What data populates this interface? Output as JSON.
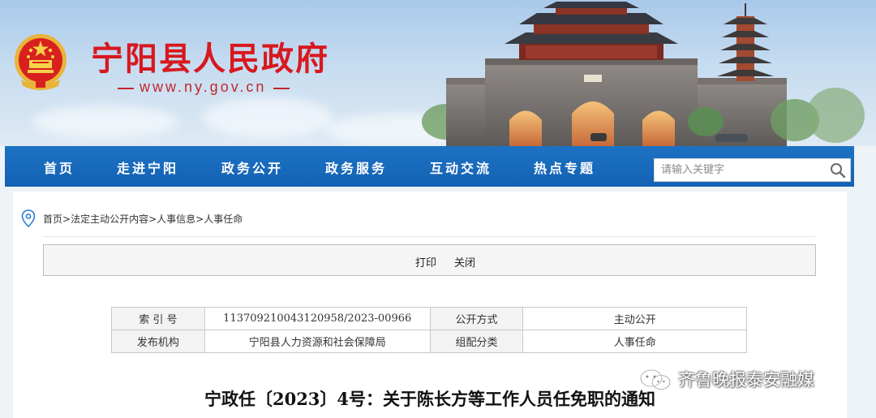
{
  "header": {
    "site_title": "宁阳县人民政府",
    "site_url": "www.ny.gov.cn"
  },
  "nav": {
    "items": [
      "首页",
      "走进宁阳",
      "政务公开",
      "政务服务",
      "互动交流",
      "热点专题"
    ],
    "search_placeholder": "请输入关键字"
  },
  "breadcrumb": {
    "items": [
      "首页",
      "法定主动公开内容",
      "人事信息",
      "人事任命"
    ]
  },
  "toolbar": {
    "print_label": "打印",
    "close_label": "关闭"
  },
  "meta_table": {
    "rows": [
      [
        "索 引 号",
        "113709210043120958/2023-00966",
        "公开方式",
        "主动公开"
      ],
      [
        "发布机构",
        "宁阳县人力资源和社会保障局",
        "组配分类",
        "人事任命"
      ]
    ]
  },
  "document": {
    "title": "宁政任〔2023〕4号：关于陈长方等工作人员任免职的通知"
  },
  "watermark": {
    "text": "齐鲁晚报泰安融媒",
    "icon": "wechat-icon"
  },
  "colors": {
    "brand_red": "#d8181e",
    "nav_blue": "#1567b9"
  }
}
